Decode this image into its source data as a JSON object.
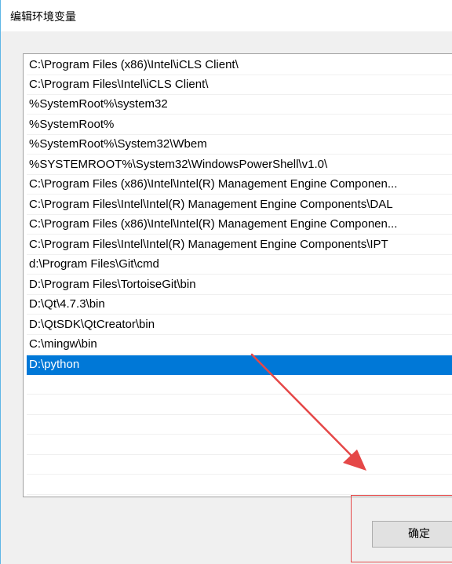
{
  "window": {
    "title": "编辑环境变量"
  },
  "path_list": {
    "items": [
      "C:\\Program Files (x86)\\Intel\\iCLS Client\\",
      "C:\\Program Files\\Intel\\iCLS Client\\",
      "%SystemRoot%\\system32",
      "%SystemRoot%",
      "%SystemRoot%\\System32\\Wbem",
      "%SYSTEMROOT%\\System32\\WindowsPowerShell\\v1.0\\",
      "C:\\Program Files (x86)\\Intel\\Intel(R) Management Engine Componen...",
      "C:\\Program Files\\Intel\\Intel(R) Management Engine Components\\DAL",
      "C:\\Program Files (x86)\\Intel\\Intel(R) Management Engine Componen...",
      "C:\\Program Files\\Intel\\Intel(R) Management Engine Components\\IPT",
      "d:\\Program Files\\Git\\cmd",
      "D:\\Program Files\\TortoiseGit\\bin",
      "D:\\Qt\\4.7.3\\bin",
      "D:\\QtSDK\\QtCreator\\bin",
      "C:\\mingw\\bin",
      "D:\\python"
    ],
    "selected_index": 15,
    "selection_color": "#0078d7"
  },
  "buttons": {
    "ok_label": "确定"
  },
  "annotation": {
    "color": "#e54848"
  }
}
